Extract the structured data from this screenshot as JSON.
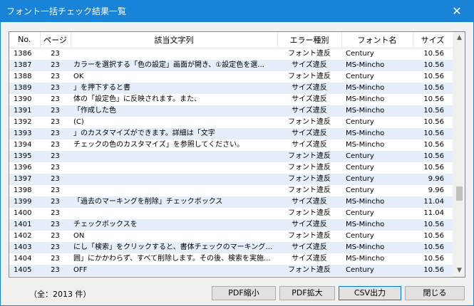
{
  "window": {
    "title": "フォント一括チェック結果一覧",
    "close_glyph": "✕"
  },
  "table": {
    "columns": [
      "No.",
      "ページ",
      "該当文字列",
      "エラー種別",
      "フォント名",
      "サイズ"
    ],
    "rows": [
      {
        "no": "1386",
        "page": "23",
        "text": "",
        "error": "フォント違反",
        "font": "Century",
        "size": "10.56"
      },
      {
        "no": "1387",
        "page": "23",
        "text": "カラーを選択する「色の設定」画面が開き、①設定色を選...",
        "error": "サイズ違反",
        "font": "MS-Mincho",
        "size": "10.56"
      },
      {
        "no": "1388",
        "page": "23",
        "text": "OK",
        "error": "フォント違反",
        "font": "Century",
        "size": "10.56"
      },
      {
        "no": "1389",
        "page": "23",
        "text": "」を押下すると書",
        "error": "サイズ違反",
        "font": "MS-Mincho",
        "size": "10.56"
      },
      {
        "no": "1390",
        "page": "23",
        "text": "体の「設定色」に反映されます。また、",
        "error": "サイズ違反",
        "font": "MS-Mincho",
        "size": "10.56"
      },
      {
        "no": "1391",
        "page": "23",
        "text": "「作成した色",
        "error": "サイズ違反",
        "font": "MS-Mincho",
        "size": "10.56"
      },
      {
        "no": "1392",
        "page": "23",
        "text": "(C)",
        "error": "フォント違反",
        "font": "Century",
        "size": "10.56"
      },
      {
        "no": "1393",
        "page": "23",
        "text": "」のカスタマイズができます。詳細は「文字",
        "error": "サイズ違反",
        "font": "MS-Mincho",
        "size": "10.56"
      },
      {
        "no": "1394",
        "page": "23",
        "text": "チェックの色のカスタマイズ」を参照してください。",
        "error": "サイズ違反",
        "font": "MS-Mincho",
        "size": "10.56"
      },
      {
        "no": "1395",
        "page": "23",
        "text": "",
        "error": "フォント違反",
        "font": "Century",
        "size": "10.56"
      },
      {
        "no": "1396",
        "page": "23",
        "text": "",
        "error": "フォント違反",
        "font": "Century",
        "size": "10.56"
      },
      {
        "no": "1397",
        "page": "23",
        "text": "",
        "error": "フォント違反",
        "font": "Century",
        "size": "9.96"
      },
      {
        "no": "1398",
        "page": "23",
        "text": "",
        "error": "フォント違反",
        "font": "Century",
        "size": "9.96"
      },
      {
        "no": "1399",
        "page": "23",
        "text": "「過去のマーキングを削除」チェックボックス",
        "error": "サイズ違反",
        "font": "MS-Mincho",
        "size": "11.04"
      },
      {
        "no": "1400",
        "page": "23",
        "text": "",
        "error": "フォント違反",
        "font": "Century",
        "size": "11.04"
      },
      {
        "no": "1401",
        "page": "23",
        "text": "チェックボックスを",
        "error": "サイズ違反",
        "font": "MS-Mincho",
        "size": "10.56"
      },
      {
        "no": "1402",
        "page": "23",
        "text": "ON",
        "error": "フォント違反",
        "font": "Century",
        "size": "10.56"
      },
      {
        "no": "1403",
        "page": "23",
        "text": "にし「検索」をクリックすると、書体チェックのマーキングを「チェ...",
        "error": "サイズ違反",
        "font": "MS-Mincho",
        "size": "10.56"
      },
      {
        "no": "1404",
        "page": "23",
        "text": "囲」にかかわらず、すべて削除します。その後、検索を実施...",
        "error": "サイズ違反",
        "font": "MS-Mincho",
        "size": "10.56"
      },
      {
        "no": "1405",
        "page": "23",
        "text": "OFF",
        "error": "フォント違反",
        "font": "Century",
        "size": "10.56"
      }
    ]
  },
  "scrollbar": {
    "up_glyph": "▲",
    "down_glyph": "▼",
    "position_fraction": 0.69
  },
  "footer": {
    "count_label": "（全：2013 件）",
    "buttons": {
      "pdf_shrink": "PDF縮小",
      "pdf_enlarge": "PDF拡大",
      "csv_export": "CSV出力",
      "close": "閉じる"
    }
  }
}
